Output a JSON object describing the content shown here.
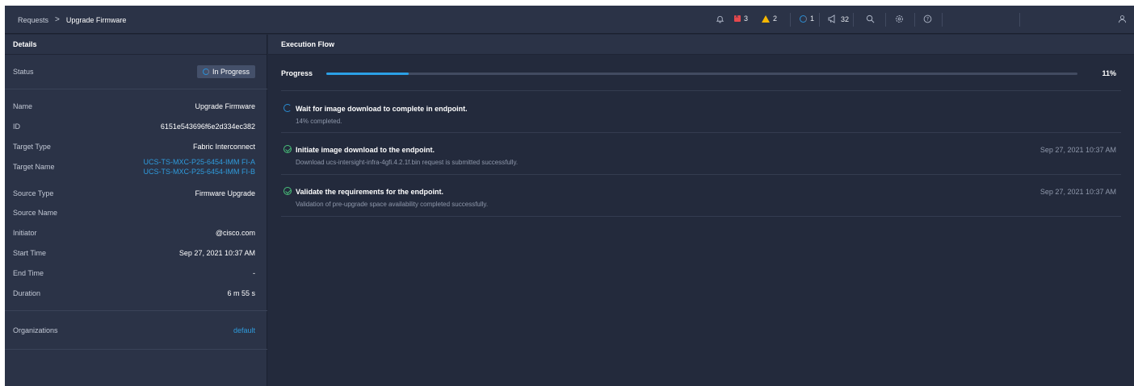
{
  "breadcrumb": {
    "parent": "Requests",
    "separator": ">",
    "current": "Upgrade Firmware"
  },
  "topbar": {
    "alarms_critical": "3",
    "alarms_warning": "2",
    "requests_count": "1",
    "notifications_count": "32",
    "icons": [
      "bell-icon",
      "critical-alarm-icon",
      "warning-icon",
      "requests-icon",
      "announcement-icon",
      "search-icon",
      "settings-icon",
      "help-icon",
      "user-icon"
    ]
  },
  "details": {
    "header": "Details",
    "status": {
      "label": "Status",
      "value": "In Progress"
    },
    "name": {
      "label": "Name",
      "value": "Upgrade Firmware"
    },
    "id": {
      "label": "ID",
      "value": "6151e543696f6e2d334ec382"
    },
    "target_type": {
      "label": "Target Type",
      "value": "Fabric Interconnect"
    },
    "target_name": {
      "label": "Target Name",
      "values": [
        "UCS-TS-MXC-P25-6454-IMM FI-A",
        "UCS-TS-MXC-P25-6454-IMM FI-B"
      ]
    },
    "source_type": {
      "label": "Source Type",
      "value": "Firmware Upgrade"
    },
    "source_name": {
      "label": "Source Name",
      "value": ""
    },
    "initiator": {
      "label": "Initiator",
      "value": "@cisco.com"
    },
    "start_time": {
      "label": "Start Time",
      "value": "Sep 27, 2021 10:37 AM"
    },
    "end_time": {
      "label": "End Time",
      "value": "-"
    },
    "duration": {
      "label": "Duration",
      "value": "6 m 55 s"
    },
    "organizations": {
      "label": "Organizations",
      "value": "default"
    }
  },
  "execution": {
    "header": "Execution Flow",
    "progress_label": "Progress",
    "progress_percent": 11,
    "progress_text": "11%",
    "steps": [
      {
        "status": "in-progress",
        "title": "Wait for image download to complete in endpoint.",
        "description": "14% completed.",
        "time": ""
      },
      {
        "status": "success",
        "title": "Initiate image download to the endpoint.",
        "description": "Download ucs-intersight-infra-4gfi.4.2.1f.bin request is submitted successfully.",
        "time": "Sep 27, 2021 10:37 AM"
      },
      {
        "status": "success",
        "title": "Validate the requirements for the endpoint.",
        "description": "Validation of pre-upgrade space availability completed successfully.",
        "time": "Sep 27, 2021 10:37 AM"
      }
    ]
  },
  "colors": {
    "accent": "#2ba0e6",
    "success": "#49c27a",
    "critical": "#e5484d",
    "warning": "#f5b700",
    "background": "#232a3c",
    "panel": "#2b3347"
  }
}
